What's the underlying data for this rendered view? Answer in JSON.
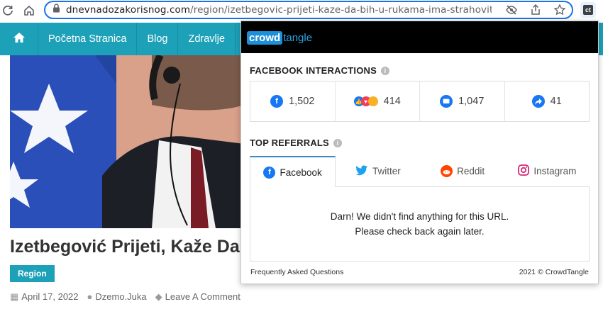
{
  "browser": {
    "url_domain": "dnevnadozakorisnog.com",
    "url_path": "/region/izetbegovic-prijeti-kaze-da-bih-u-rukama-ima-strahovito-oruzj...",
    "extension_label": "ct"
  },
  "site": {
    "nav": [
      "Početna Stranica",
      "Blog",
      "Zdravlje"
    ],
    "headline": "Izetbegović Prijeti, Kaže Da",
    "category": "Region",
    "date": "April 17, 2022",
    "author": "Dzemo.Juka",
    "comments": "Leave A Comment"
  },
  "popup": {
    "logo_left": "crowd",
    "logo_right": "tangle",
    "interactions_title": "FACEBOOK INTERACTIONS",
    "stats": [
      {
        "icon": "facebook-icon",
        "value": "1,502",
        "color": "#1877f2"
      },
      {
        "icon": "reactions-icon",
        "value": "414",
        "color": "#1877f2"
      },
      {
        "icon": "comment-icon",
        "value": "1,047",
        "color": "#1877f2"
      },
      {
        "icon": "share-icon",
        "value": "41",
        "color": "#1877f2"
      }
    ],
    "referrals_title": "TOP REFERRALS",
    "tabs": [
      {
        "label": "Facebook",
        "icon": "facebook-icon",
        "color": "#1877f2"
      },
      {
        "label": "Twitter",
        "icon": "twitter-icon",
        "color": "#1da1f2"
      },
      {
        "label": "Reddit",
        "icon": "reddit-icon",
        "color": "#ff4500"
      },
      {
        "label": "Instagram",
        "icon": "instagram-icon",
        "color": "#d62976"
      }
    ],
    "message_line1": "Darn! We didn't find anything for this URL.",
    "message_line2": "Please check back again later.",
    "faq_link": "Frequently Asked Questions",
    "copyright": "2021 © CrowdTangle"
  },
  "colors": {
    "brand_teal": "#1da1b8",
    "focus_blue": "#1a73e8"
  }
}
